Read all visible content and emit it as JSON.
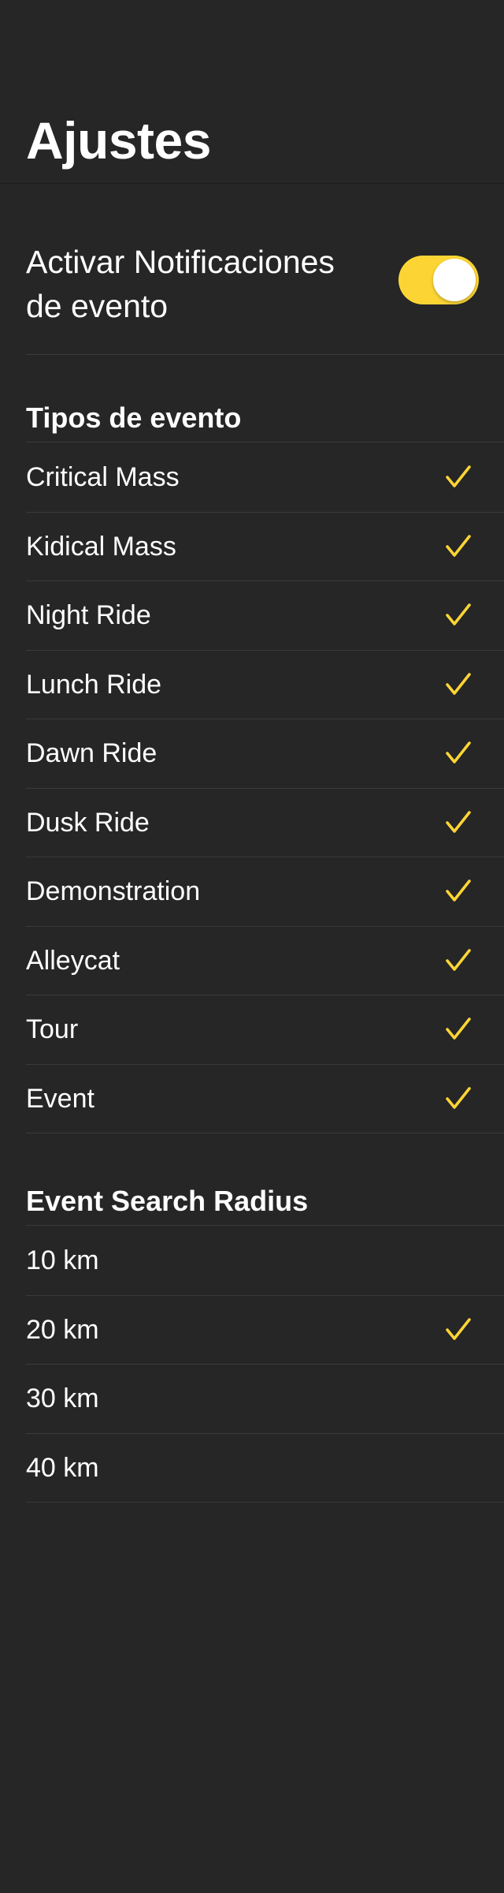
{
  "header": {
    "title": "Ajustes"
  },
  "notifications": {
    "label": "Activar Notificaciones de evento",
    "enabled": true
  },
  "event_types": {
    "title": "Tipos de evento",
    "items": [
      {
        "label": "Critical Mass",
        "checked": true
      },
      {
        "label": "Kidical Mass",
        "checked": true
      },
      {
        "label": "Night Ride",
        "checked": true
      },
      {
        "label": "Lunch Ride",
        "checked": true
      },
      {
        "label": "Dawn Ride",
        "checked": true
      },
      {
        "label": "Dusk Ride",
        "checked": true
      },
      {
        "label": "Demonstration",
        "checked": true
      },
      {
        "label": "Alleycat",
        "checked": true
      },
      {
        "label": "Tour",
        "checked": true
      },
      {
        "label": "Event",
        "checked": true
      }
    ]
  },
  "search_radius": {
    "title": "Event Search Radius",
    "items": [
      {
        "label": "10 km",
        "checked": false
      },
      {
        "label": "20 km",
        "checked": true
      },
      {
        "label": "30 km",
        "checked": false
      },
      {
        "label": "40 km",
        "checked": false
      }
    ]
  },
  "colors": {
    "background": "#262626",
    "accent": "#fcd535",
    "separator": "#3a3a3a",
    "text": "#ffffff"
  },
  "icons": {
    "check": "checkmark-icon"
  }
}
